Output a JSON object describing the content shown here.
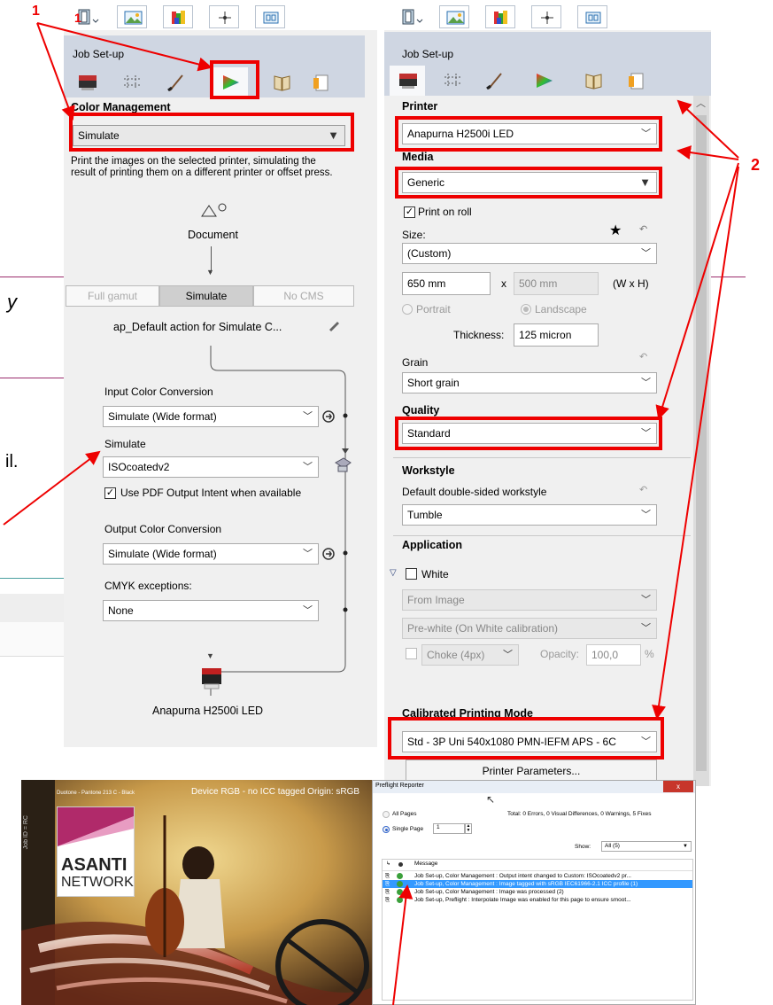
{
  "markers": {
    "one": "1",
    "two": "2"
  },
  "background_fragments": {
    "left_text_1": "y",
    "left_text_2": "il."
  },
  "left_panel": {
    "title": "Job Set-up",
    "section_title": "Color Management",
    "mode_select": "Simulate",
    "description": "Print the images on the selected printer, simulating the result of printing them on a different printer or offset press.",
    "document_label": "Document",
    "segments": [
      "Full gamut",
      "Simulate",
      "No CMS"
    ],
    "selected_segment": "Simulate",
    "action_label": "ap_Default action for Simulate C...",
    "input_conversion_label": "Input Color Conversion",
    "input_conversion_value": "Simulate (Wide format)",
    "simulate_label": "Simulate",
    "simulate_value": "ISOcoatedv2",
    "use_pdf_intent_label": "Use PDF Output Intent when available",
    "use_pdf_intent_checked": true,
    "output_conversion_label": "Output Color Conversion",
    "output_conversion_value": "Simulate (Wide format)",
    "cmyk_exceptions_label": "CMYK exceptions:",
    "cmyk_exceptions_value": "None",
    "printer_name": "Anapurna H2500i LED"
  },
  "right_panel": {
    "title": "Job Set-up",
    "printer_label": "Printer",
    "printer_value": "Anapurna H2500i LED",
    "media_label": "Media",
    "media_value": "Generic",
    "print_on_roll_label": "Print on roll",
    "print_on_roll_checked": true,
    "size_label": "Size:",
    "size_value": "(Custom)",
    "width_value": "650 mm",
    "x_label": "x",
    "height_value": "500 mm",
    "wh_label": "(W x H)",
    "portrait_label": "Portrait",
    "landscape_label": "Landscape",
    "thickness_label": "Thickness:",
    "thickness_value": "125 micron",
    "grain_label": "Grain",
    "grain_value": "Short grain",
    "quality_label": "Quality",
    "quality_value": "Standard",
    "workstyle_label": "Workstyle",
    "default_workstyle_label": "Default double-sided workstyle",
    "workstyle_value": "Tumble",
    "application_label": "Application",
    "white_label": "White",
    "from_image_value": "From Image",
    "prewhite_value": "Pre-white (On White calibration)",
    "choke_value": "Choke (4px)",
    "opacity_label": "Opacity:",
    "opacity_value": "100,0",
    "percent_label": "%",
    "calibrated_mode_label": "Calibrated Printing Mode",
    "calibrated_mode_value": "Std - 3P Uni 540x1080 PMN-IEFM APS - 6C",
    "printer_parameters_button": "Printer Parameters..."
  },
  "preview": {
    "header_left": "Duotone - Pantone 213 C - Black",
    "header_right": "Device RGB - no ICC tagged Origin: sRGB",
    "logo_line1": "ASANTI",
    "logo_line2": "NETWORK",
    "side_text": "Job ID = RC"
  },
  "preflight": {
    "title": "Preflight Reporter",
    "close": "x",
    "all_pages_label": "All Pages",
    "single_page_label": "Single Page",
    "page_value": "1",
    "totals": "Total: 0 Errors, 0 Visual Differences, 0 Warnings, 5 Fixes",
    "show_label": "Show:",
    "show_value": "All (5)",
    "message_header": "Message",
    "rows": [
      "Job Set-up, Color Management : Output intent changed to Custom: ISOcoatedv2 pr...",
      "Job Set-up, Color Management : Image tagged with sRGB IEC61966-2.1 ICC profile (1)",
      "Job Set-up, Color Management : Image was processed (2)",
      "Job Set-up, Preflight : Interpolate Image was enabled for this page to ensure smoot..."
    ],
    "selected_row": 1
  },
  "colors": {
    "annotation_red": "#e00000",
    "selection_blue": "#3399ff",
    "panel_bg": "#f0f0f0",
    "jobbar": "#cfd6e2"
  }
}
